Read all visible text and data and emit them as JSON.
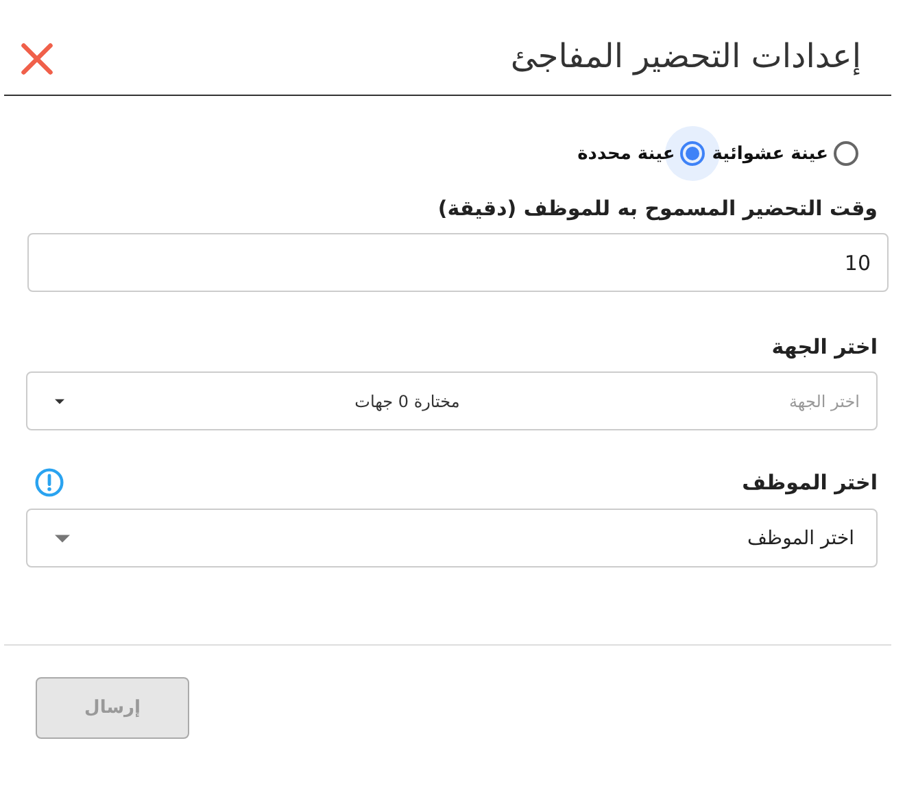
{
  "dialog": {
    "title": "إعدادات التحضير المفاجئ"
  },
  "sample_options": [
    {
      "label": "عينة عشوائية",
      "selected": false
    },
    {
      "label": "عينة محددة",
      "selected": true
    }
  ],
  "time_field": {
    "label": "وقت التحضير المسموح به للموظف (دقيقة)",
    "value": "10"
  },
  "department_select": {
    "label": "اختر الجهة",
    "placeholder": "اختر الجهة",
    "value": "مختارة 0 جهات"
  },
  "employee_select": {
    "label": "اختر الموظف",
    "value": "اختر الموظف",
    "info": true
  },
  "submit_button": {
    "label": "إرسال",
    "disabled": true
  }
}
